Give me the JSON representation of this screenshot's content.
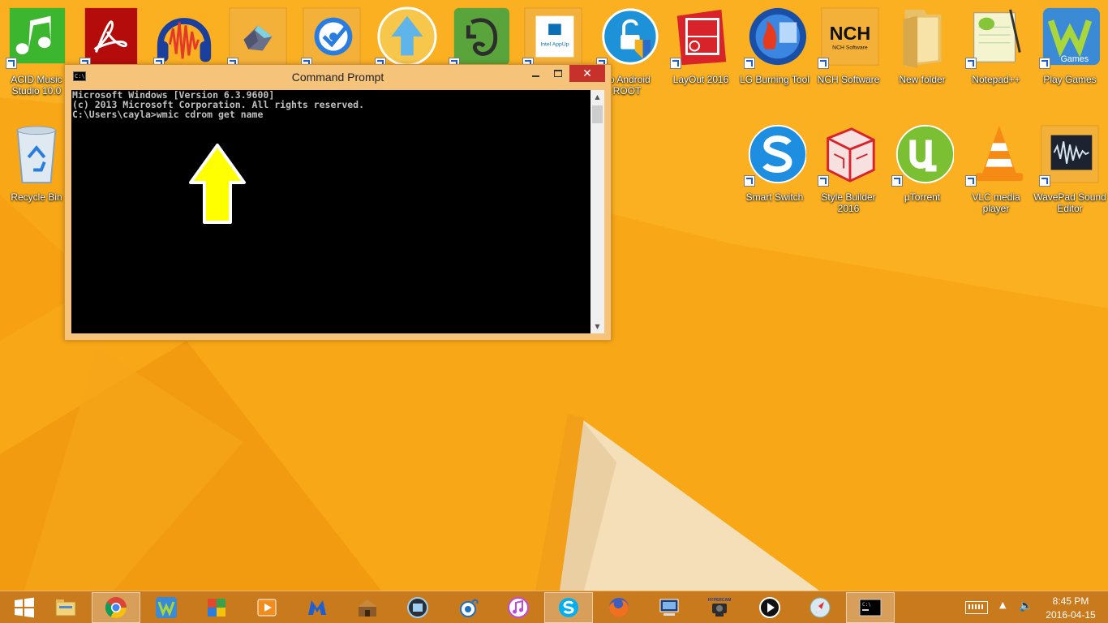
{
  "desktop": {
    "icons": [
      {
        "label": "ACID Music Studio 10.0"
      },
      {
        "label": ""
      },
      {
        "label": ""
      },
      {
        "label": ""
      },
      {
        "label": ""
      },
      {
        "label": ""
      },
      {
        "label": ""
      },
      {
        "label": ""
      },
      {
        "label": "go Android ROOT"
      },
      {
        "label": "LayOut 2016"
      },
      {
        "label": "LG Burning Tool"
      },
      {
        "label": "NCH Software"
      },
      {
        "label": "New folder"
      },
      {
        "label": "Notepad++"
      },
      {
        "label": "Play Games"
      },
      {
        "label": "Recycle Bin"
      },
      {
        "label": "Smart Switch"
      },
      {
        "label": "Style Builder 2016"
      },
      {
        "label": "µTorrent"
      },
      {
        "label": "VLC media player"
      },
      {
        "label": "WavePad Sound Editor"
      }
    ],
    "icon_text": {
      "nch_logo": "NCH",
      "nch_sub": "NCH Software",
      "intel_appup": "Intel AppUp"
    }
  },
  "cmd": {
    "title": "Command Prompt",
    "app_icon_text": "C:\\",
    "close_glyph": "✕",
    "lines": [
      "Microsoft Windows [Version 6.3.9600]",
      "(c) 2013 Microsoft Corporation. All rights reserved.",
      "",
      "C:\\Users\\cayla>wmic cdrom get name"
    ],
    "scroll_up": "▲",
    "scroll_down": "▼"
  },
  "taskbar": {
    "items": [
      {
        "icon": "windows-start-icon"
      },
      {
        "icon": "file-explorer-icon"
      },
      {
        "icon": "chrome-icon",
        "active": true
      },
      {
        "icon": "wildtangent-games-icon"
      },
      {
        "icon": "app-icon"
      },
      {
        "icon": "video-player-icon"
      },
      {
        "icon": "malwarebytes-icon"
      },
      {
        "icon": "game-icon"
      },
      {
        "icon": "film-icon"
      },
      {
        "icon": "bird-icon"
      },
      {
        "icon": "itunes-icon"
      },
      {
        "icon": "skype-icon",
        "active": true
      },
      {
        "icon": "firefox-icon"
      },
      {
        "icon": "remote-desktop-icon"
      },
      {
        "icon": "hypercam-icon"
      },
      {
        "icon": "media-player-icon"
      },
      {
        "icon": "safari-icon"
      },
      {
        "icon": "command-prompt-icon",
        "active": true
      }
    ],
    "hypercam_text": "HYPERCAM",
    "chevron": "▲",
    "volume": "🔈",
    "clock_time": "8:45 PM",
    "clock_date": "2016-04-15"
  },
  "colors": {
    "wallpaper": "#f7a312",
    "taskbar": "#c97a1c",
    "window_frame": "#f6c37a",
    "close_button": "#c7312b",
    "console_bg": "#000000",
    "console_text": "#c0c0c0",
    "arrow": "#ffff00"
  }
}
